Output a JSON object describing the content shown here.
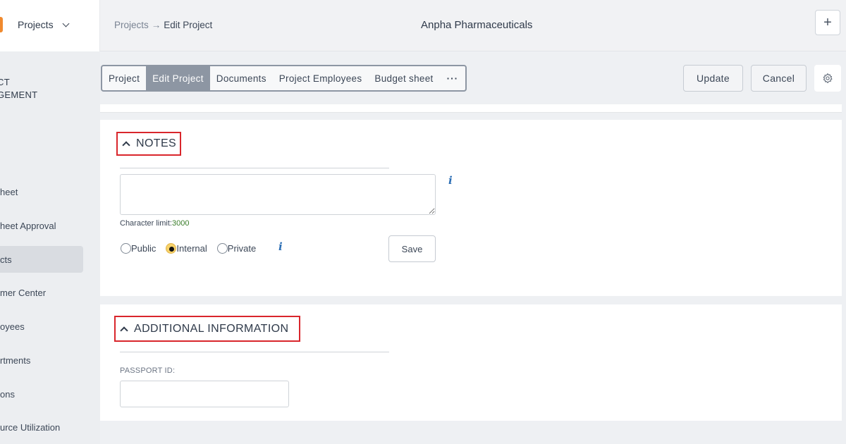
{
  "header": {
    "module": "Projects",
    "breadcrumb_parent": "Projects",
    "breadcrumb_arrow": "→",
    "breadcrumb_current": "Edit Project",
    "company": "Anpha Pharmaceuticals",
    "add_label": "+"
  },
  "sidebar": {
    "title_line1": "CT",
    "title_line2": "GEMENT",
    "items": [
      {
        "label": "heet"
      },
      {
        "label": "heet Approval"
      },
      {
        "label": "cts"
      },
      {
        "label": "mer Center"
      },
      {
        "label": "oyees"
      },
      {
        "label": "rtments"
      },
      {
        "label": "ons"
      },
      {
        "label": "urce Utilization"
      }
    ]
  },
  "tabs": [
    {
      "label": "Project"
    },
    {
      "label": "Edit Project"
    },
    {
      "label": "Documents"
    },
    {
      "label": "Project Employees"
    },
    {
      "label": "Budget sheet"
    },
    {
      "label": "···"
    }
  ],
  "actions": {
    "update": "Update",
    "cancel": "Cancel"
  },
  "notes": {
    "title": "NOTES",
    "char_limit_label": "Character limit:",
    "char_limit_value": "3000",
    "visibility": {
      "options": [
        "Public",
        "Internal",
        "Private"
      ],
      "selected": "Internal"
    },
    "save": "Save",
    "info_glyph": "i"
  },
  "additional": {
    "title": "ADDITIONAL INFORMATION",
    "passport_label": "PASSPORT ID:",
    "passport_value": ""
  },
  "colors": {
    "highlight_border": "#d9262c",
    "accent_orange": "#f08a2e",
    "info_blue": "#2d6fb5",
    "active_tab": "#8d96a3"
  },
  "icons": {
    "dropdown": "chevron-down-icon",
    "add": "plus-icon",
    "settings": "gear-icon",
    "collapse": "chevron-up-icon",
    "info": "info-icon"
  }
}
